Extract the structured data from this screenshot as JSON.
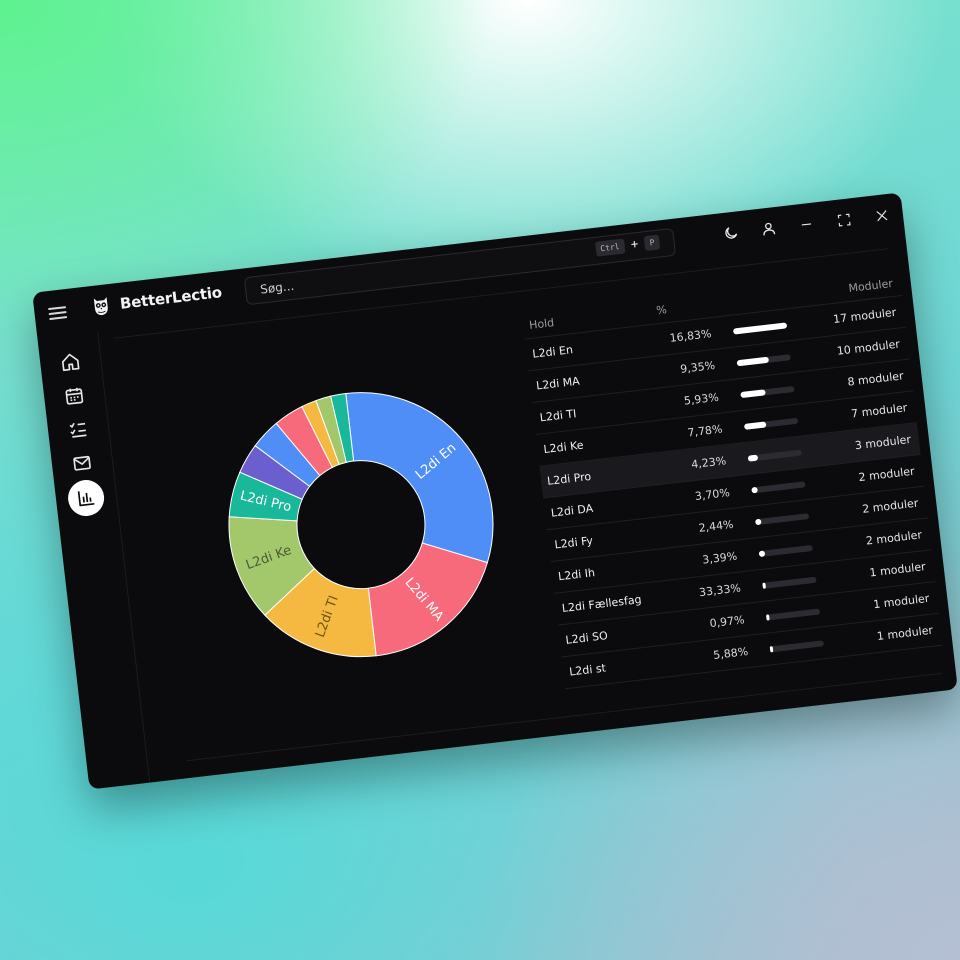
{
  "app": {
    "name": "BetterLectio"
  },
  "search": {
    "placeholder": "Søg...",
    "shortcut_key1": "Ctrl",
    "shortcut_plus": "+",
    "shortcut_key2": "P"
  },
  "icons": {
    "menu": "menu-icon",
    "theme": "moon-icon",
    "profile": "user-icon",
    "minimize": "minimize-icon",
    "maximize": "maximize-icon",
    "close": "close-icon"
  },
  "sidebar": {
    "items": [
      {
        "name": "home",
        "icon": "home-icon",
        "active": false
      },
      {
        "name": "calendar",
        "icon": "calendar-icon",
        "active": false
      },
      {
        "name": "tasks",
        "icon": "checklist-icon",
        "active": false
      },
      {
        "name": "messages",
        "icon": "mail-icon",
        "active": false
      },
      {
        "name": "stats",
        "icon": "bar-chart-icon",
        "active": true
      }
    ]
  },
  "table": {
    "headers": {
      "hold": "Hold",
      "pct": "%",
      "modules": "Moduler"
    },
    "rows": [
      {
        "hold": "L2di En",
        "pct": "16,83%",
        "fill": 1.0,
        "modules": "17 moduler"
      },
      {
        "hold": "L2di MA",
        "pct": "9,35%",
        "fill": 0.59,
        "modules": "10 moduler"
      },
      {
        "hold": "L2di TI",
        "pct": "5,93%",
        "fill": 0.47,
        "modules": "8 moduler"
      },
      {
        "hold": "L2di Ke",
        "pct": "7,78%",
        "fill": 0.41,
        "modules": "7 moduler"
      },
      {
        "hold": "L2di Pro",
        "pct": "4,23%",
        "fill": 0.18,
        "modules": "3 moduler"
      },
      {
        "hold": "L2di DA",
        "pct": "3,70%",
        "fill": 0.12,
        "modules": "2 moduler"
      },
      {
        "hold": "L2di Fy",
        "pct": "2,44%",
        "fill": 0.12,
        "modules": "2 moduler"
      },
      {
        "hold": "L2di Ih",
        "pct": "3,39%",
        "fill": 0.12,
        "modules": "2 moduler"
      },
      {
        "hold": "L2di Fællesfag",
        "pct": "33,33%",
        "fill": 0.06,
        "modules": "1 moduler"
      },
      {
        "hold": "L2di SO",
        "pct": "0,97%",
        "fill": 0.06,
        "modules": "1 moduler"
      },
      {
        "hold": "L2di st",
        "pct": "5,88%",
        "fill": 0.06,
        "modules": "1 moduler"
      }
    ],
    "highlighted_row": 4
  },
  "chart_data": {
    "type": "pie",
    "donut": true,
    "categories": [
      "L2di En",
      "L2di MA",
      "L2di TI",
      "L2di Ke",
      "L2di Pro",
      "L2di DA",
      "L2di Fy",
      "L2di Ih",
      "L2di Fællesfag",
      "L2di SO",
      "L2di st"
    ],
    "values": [
      17,
      10,
      8,
      7,
      3,
      2,
      2,
      2,
      1,
      1,
      1
    ],
    "slice_labels": [
      "L2di En",
      "L2di MA",
      "L2di TI",
      "L2di Ke",
      "L2di Pro",
      "",
      "",
      "",
      "",
      "",
      ""
    ],
    "colors": [
      "#4f8ef7",
      "#f76a7c",
      "#f5b942",
      "#a3c86c",
      "#19b89a",
      "#6b5fcf",
      "#4f8ef7",
      "#f76a7c",
      "#f5b942",
      "#a3c86c",
      "#19b89a"
    ]
  }
}
